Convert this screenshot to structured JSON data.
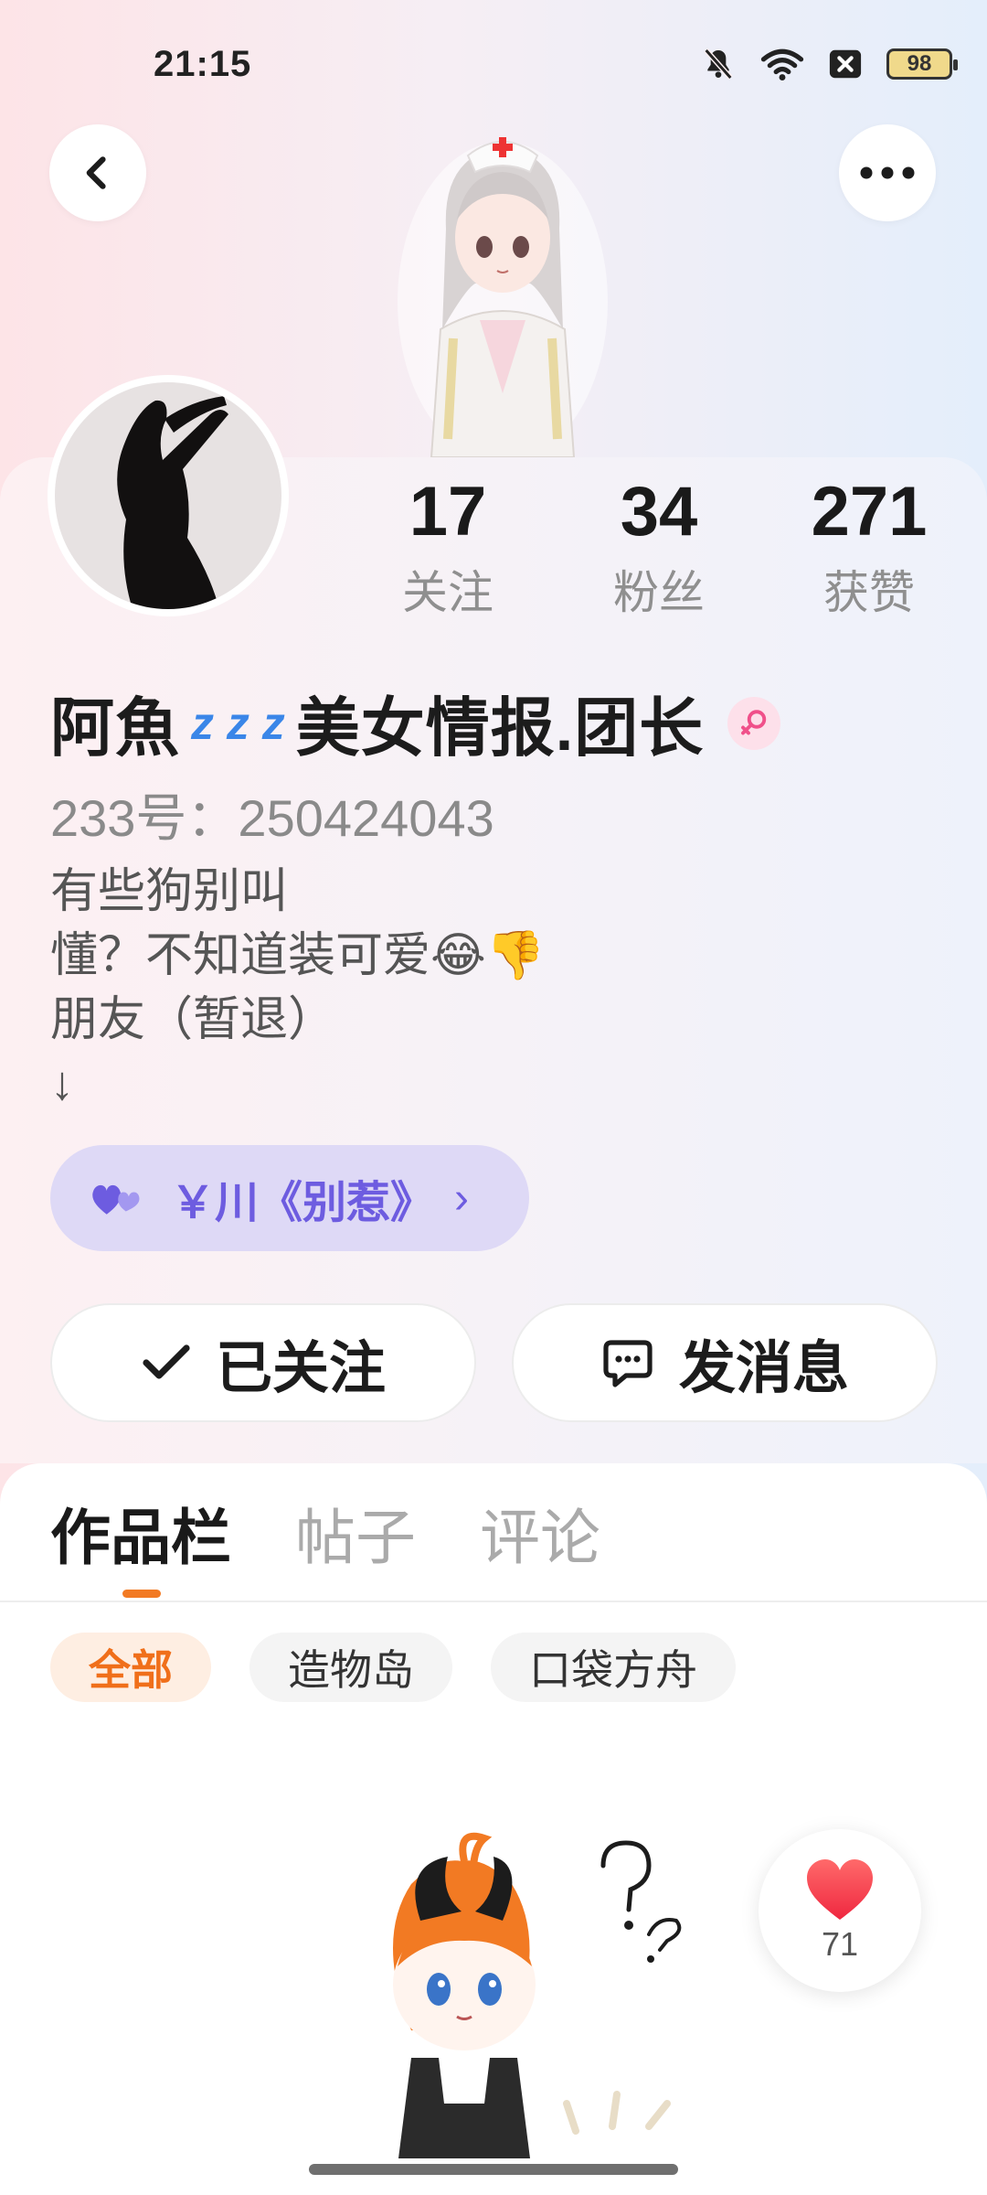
{
  "status_bar": {
    "time": "21:15",
    "battery": "98"
  },
  "profile": {
    "stats": [
      {
        "value": "17",
        "label": "关注"
      },
      {
        "value": "34",
        "label": "粉丝"
      },
      {
        "value": "271",
        "label": "获赞"
      }
    ],
    "name": "阿魚",
    "name_emoji": "z z z",
    "name_suffix": "美女情报.团长",
    "uid": "233号：250424043",
    "bio_lines": [
      "有些狗别叫",
      "懂？不知道装可爱😂👎",
      "朋友（暂退）",
      "↓"
    ],
    "music_pill": "￥川《别惹》",
    "music_pill_chevron": "›",
    "follow_button": "已关注",
    "message_button": "发消息"
  },
  "tabs": {
    "items": [
      "作品栏",
      "帖子",
      "评论"
    ],
    "active": 0
  },
  "filter_chips": {
    "items": [
      "全部",
      "造物岛",
      "口袋方舟"
    ],
    "active": 0
  },
  "like_badge": {
    "count": "71"
  },
  "colors": {
    "accent": "#f27a23",
    "music_pill": "#6d5ce0",
    "heart": "#f2364a"
  }
}
